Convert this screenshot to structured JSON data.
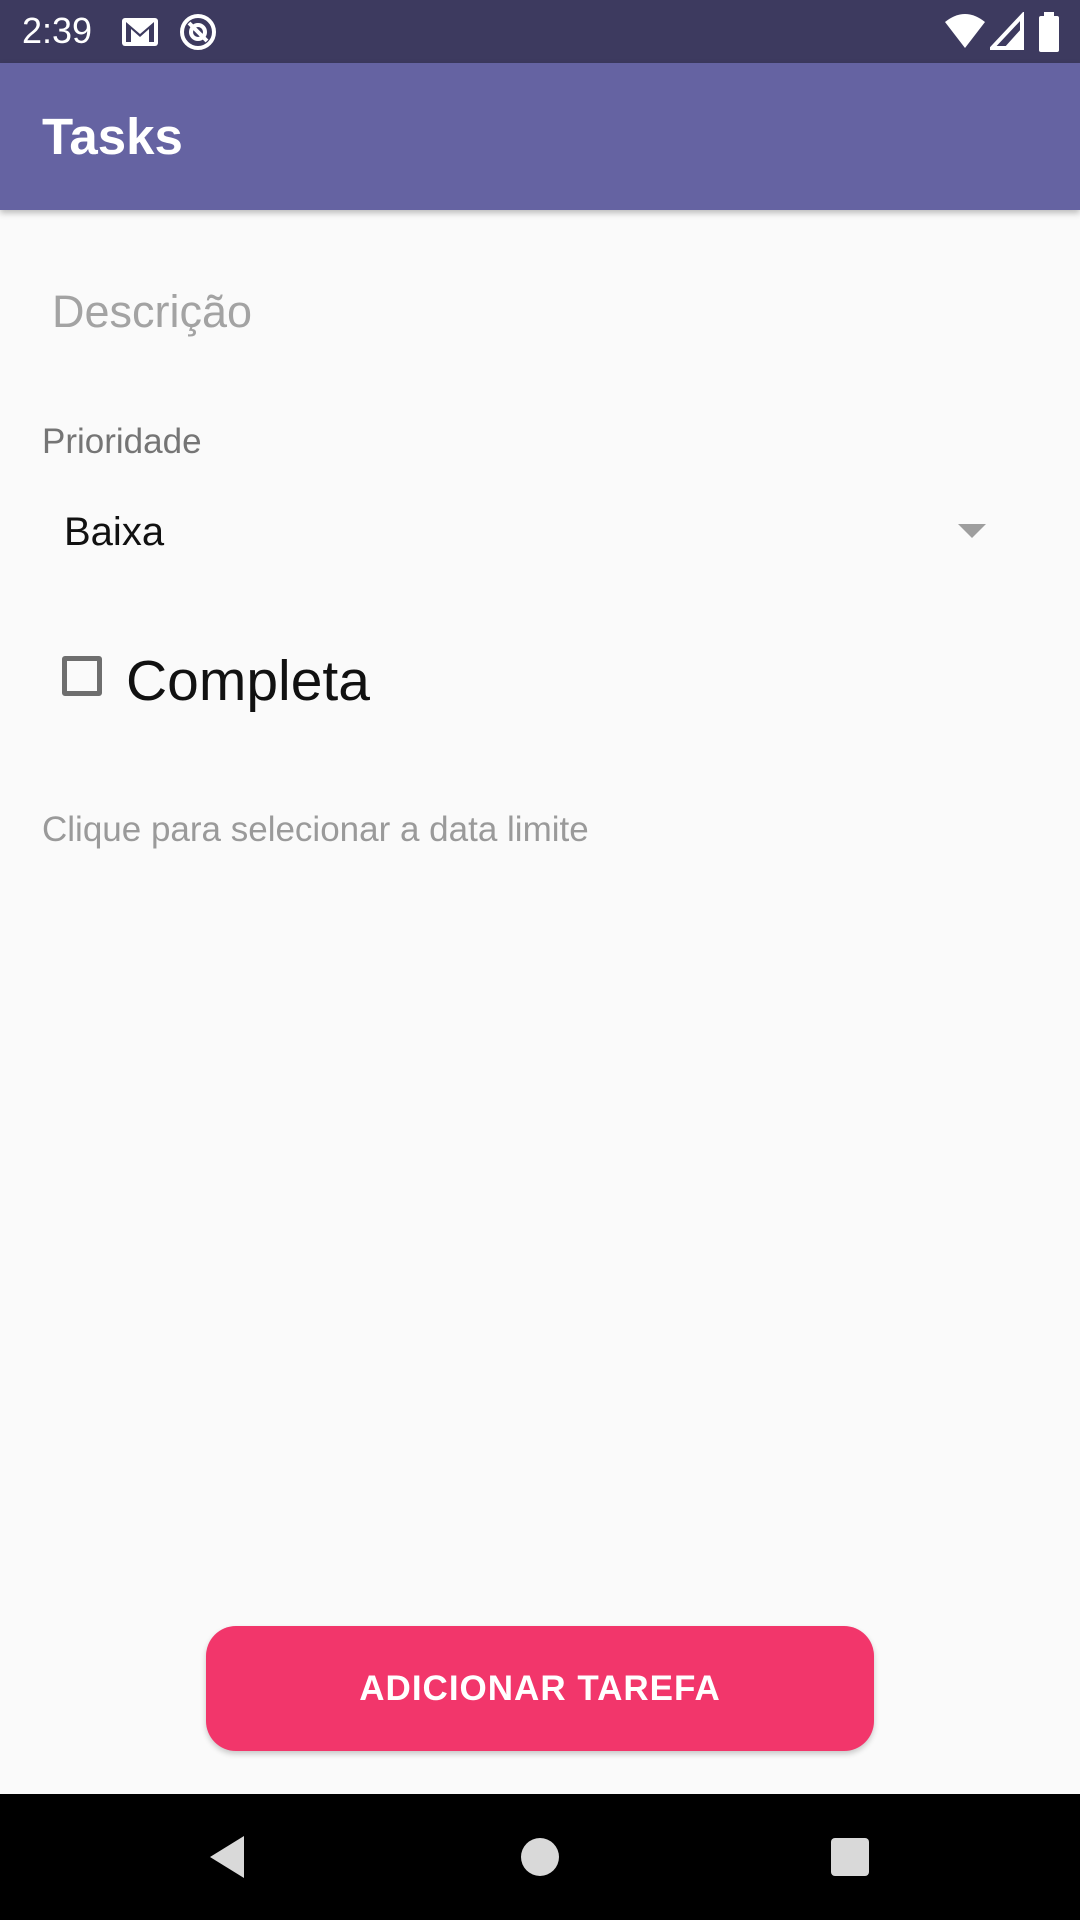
{
  "status_bar": {
    "time": "2:39",
    "icons_left": [
      "gmail-icon",
      "at-sign-icon"
    ],
    "icons_right": [
      "wifi-icon",
      "signal-icon",
      "battery-icon"
    ],
    "background": "#3d3a5f"
  },
  "app_bar": {
    "title": "Tasks",
    "background": "#6563a2"
  },
  "form": {
    "description_placeholder": "Descrição",
    "description_value": "",
    "priority_label": "Prioridade",
    "priority_selected": "Baixa",
    "completed_label": "Completa",
    "completed_checked": false,
    "deadline_hint": "Clique para selecionar a data limite"
  },
  "actions": {
    "add_label": "ADICIONAR TAREFA",
    "add_color": "#f2366b"
  },
  "nav_bar": {
    "buttons": [
      "back-icon",
      "home-icon",
      "recents-icon"
    ]
  }
}
